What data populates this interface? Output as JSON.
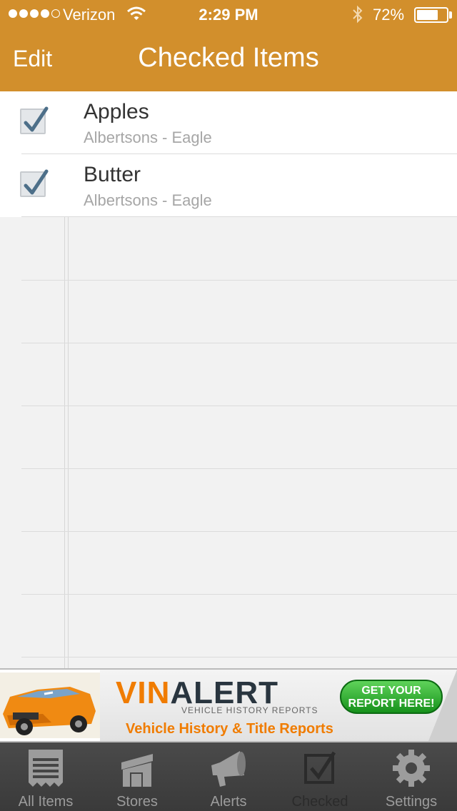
{
  "status_bar": {
    "carrier": "Verizon",
    "time": "2:29 PM",
    "battery_percent": "72%",
    "battery_level": 0.72,
    "signal_bars_filled": 4,
    "signal_bars_total": 5
  },
  "nav": {
    "edit_label": "Edit",
    "title": "Checked Items"
  },
  "items": [
    {
      "name": "Apples",
      "store": "Albertsons - Eagle",
      "checked": true
    },
    {
      "name": "Butter",
      "store": "Albertsons - Eagle",
      "checked": true
    }
  ],
  "ad": {
    "brand_part1": "VIN",
    "brand_part2": "ALERT",
    "subtitle": "VEHICLE HISTORY REPORTS",
    "tagline": "Vehicle History & Title Reports",
    "cta_line1": "GET YOUR",
    "cta_line2": "REPORT HERE!"
  },
  "tabs": [
    {
      "label": "All Items",
      "icon": "receipt-icon",
      "active": false
    },
    {
      "label": "Stores",
      "icon": "store-icon",
      "active": false
    },
    {
      "label": "Alerts",
      "icon": "megaphone-icon",
      "active": false
    },
    {
      "label": "Checked",
      "icon": "checkbox-icon",
      "active": true
    },
    {
      "label": "Settings",
      "icon": "gear-icon",
      "active": false
    }
  ],
  "colors": {
    "accent": "#d28f2c",
    "tabbar": "#404040",
    "ad_orange": "#f07c00",
    "ad_green": "#1fa324"
  }
}
